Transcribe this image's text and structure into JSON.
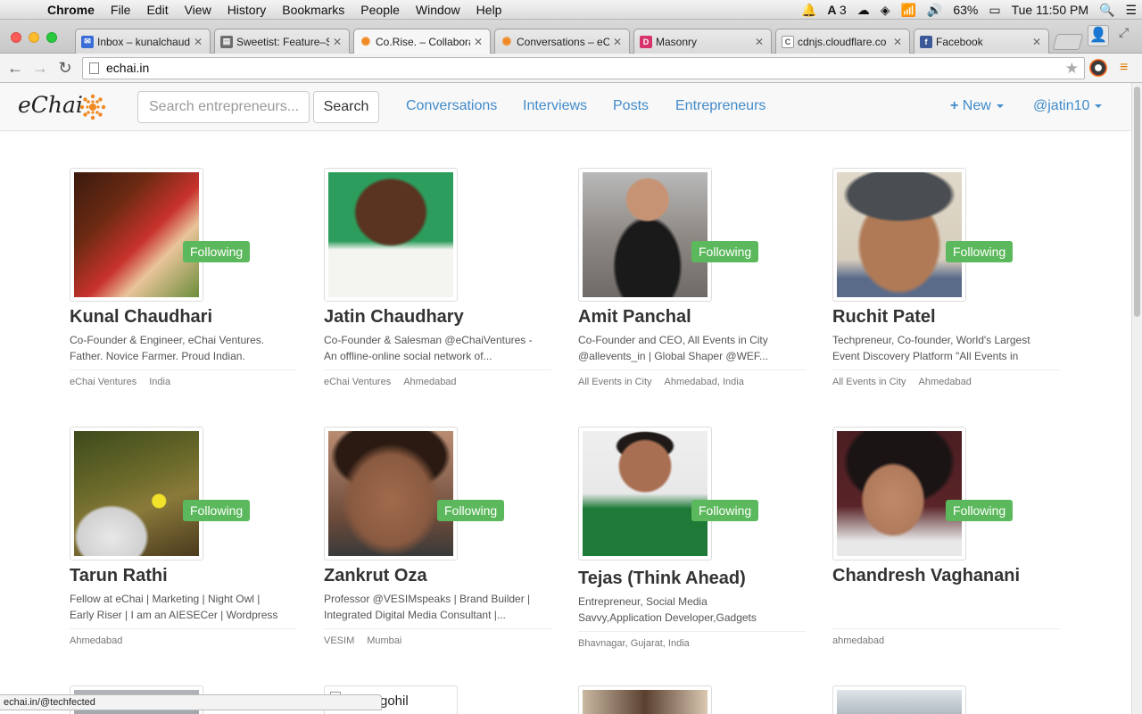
{
  "os_menubar": {
    "app": "Chrome",
    "items": [
      "File",
      "Edit",
      "View",
      "History",
      "Bookmarks",
      "People",
      "Window",
      "Help"
    ],
    "battery": "63%",
    "clock": "Tue 11:50 PM",
    "adobe_badge": "3"
  },
  "tabs": [
    {
      "title": "Inbox – kunalchaud",
      "color": "#3b6dd8",
      "glyph": "✉"
    },
    {
      "title": "Sweetist: Feature–S",
      "color": "#6d6d6d",
      "glyph": "▤"
    },
    {
      "title": "Co.Rise. – Collabora",
      "color": "#f08a24",
      "glyph": "✺"
    },
    {
      "title": "Conversations – eC",
      "color": "#f08a24",
      "glyph": "✺"
    },
    {
      "title": "Masonry",
      "color": "#d6336c",
      "glyph": "D"
    },
    {
      "title": "cdnjs.cloudflare.co",
      "color": "#888888",
      "glyph": "C"
    },
    {
      "title": "Facebook",
      "color": "#3b5998",
      "glyph": "f"
    }
  ],
  "browser": {
    "url": "echai.in"
  },
  "site": {
    "brand": "eChai",
    "search_placeholder": "Search entrepreneurs...",
    "search_button": "Search",
    "nav": [
      "Conversations",
      "Interviews",
      "Posts",
      "Entrepreneurs"
    ],
    "new_label": "New",
    "user_label": "@jatin10"
  },
  "follow_label": "Following",
  "people": [
    {
      "name": "Kunal Chaudhari",
      "bio": "Co-Founder & Engineer, eChai Ventures. Father. Novice Farmer. Proud Indian.",
      "meta": [
        "eChai Ventures",
        "India"
      ],
      "following": true
    },
    {
      "name": "Jatin Chaudhary",
      "bio": "Co-Founder & Salesman @eChaiVentures - An offline-online social network of...",
      "meta": [
        "eChai Ventures",
        "Ahmedabad"
      ],
      "following": false
    },
    {
      "name": "Amit Panchal",
      "bio": "Co-Founder and CEO, All Events in City @allevents_in | Global Shaper @WEF...",
      "meta": [
        "All Events in City",
        "Ahmedabad, India"
      ],
      "following": true
    },
    {
      "name": "Ruchit Patel",
      "bio": "Techpreneur, Co-founder, World's Largest Event Discovery Platform \"All Events in",
      "meta": [
        "All Events in City",
        "Ahmedabad"
      ],
      "following": true
    },
    {
      "name": "Tarun Rathi",
      "bio": "Fellow at eChai | Marketing | Night Owl | Early Riser | I am an AIESECer | Wordpress",
      "meta": [
        "Ahmedabad"
      ],
      "following": true
    },
    {
      "name": "Zankrut Oza",
      "bio": "Professor @VESIMspeaks | Brand Builder | Integrated Digital Media Consultant |...",
      "meta": [
        "VESIM",
        "Mumbai"
      ],
      "following": true
    },
    {
      "name": "Tejas (Think Ahead)",
      "bio": "Entrepreneur, Social Media Savvy,Application Developer,Gadgets",
      "meta": [
        "Bhavnagar, Gujarat, India"
      ],
      "following": true
    },
    {
      "name": "Chandresh Vaghanani",
      "bio": "",
      "meta": [
        "ahmedabad"
      ],
      "following": true
    }
  ],
  "partial_row_alt": "gohil",
  "status_url": "echai.in/@techfected"
}
